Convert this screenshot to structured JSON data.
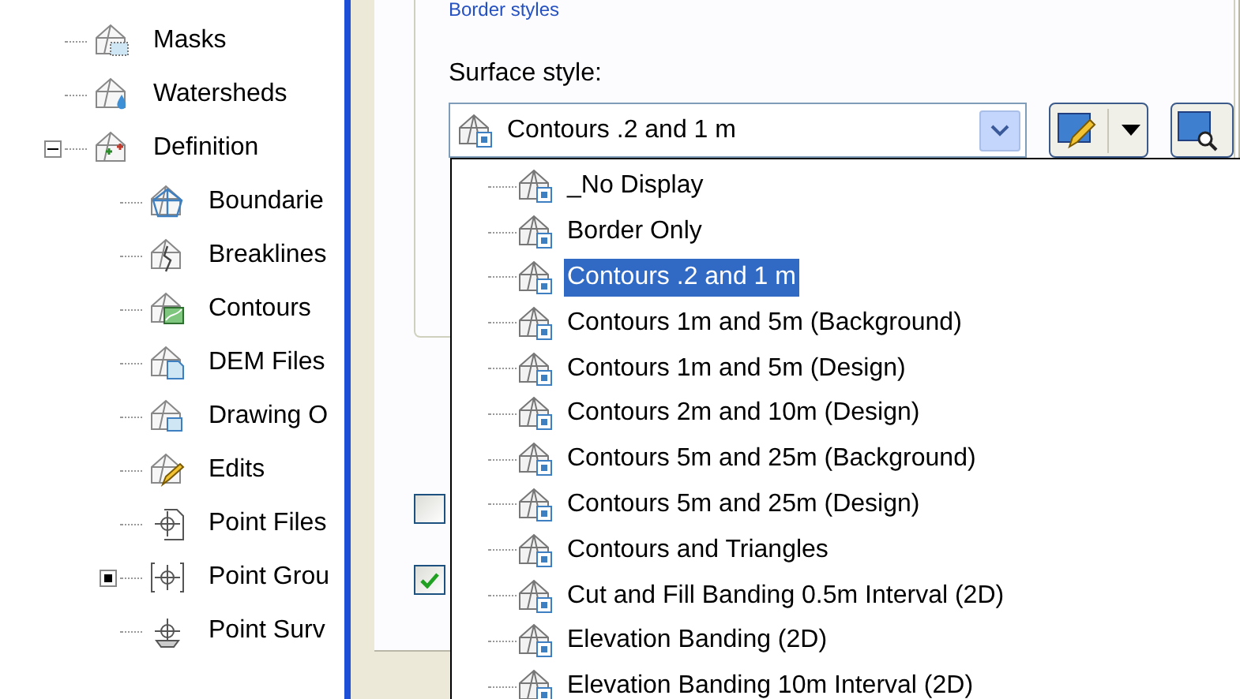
{
  "tree": {
    "items": [
      {
        "label": "Masks",
        "kind": "mask"
      },
      {
        "label": "Watersheds",
        "kind": "watershed"
      },
      {
        "label": "Definition",
        "kind": "definition",
        "expanded": true,
        "children": [
          {
            "label": "Boundarie",
            "kind": "boundary"
          },
          {
            "label": "Breaklines",
            "kind": "breakline"
          },
          {
            "label": "Contours",
            "kind": "contour"
          },
          {
            "label": "DEM Files",
            "kind": "dem"
          },
          {
            "label": "Drawing O",
            "kind": "drawing"
          },
          {
            "label": "Edits",
            "kind": "edit"
          },
          {
            "label": "Point Files",
            "kind": "pointfile"
          },
          {
            "label": "Point Grou",
            "kind": "pointgroup",
            "expanded": false
          },
          {
            "label": "Point Surv",
            "kind": "pointsurvey"
          }
        ]
      }
    ]
  },
  "group": {
    "title": "Border styles",
    "surface_style": {
      "label": "Surface style:",
      "value": "Contours .2 and 1 m"
    }
  },
  "checkboxes": [
    {
      "checked": false
    },
    {
      "checked": true
    }
  ],
  "style_list": [
    {
      "label": "_No Display",
      "selected": false
    },
    {
      "label": "Border Only",
      "selected": false
    },
    {
      "label": "Contours .2 and 1 m",
      "selected": true
    },
    {
      "label": "Contours 1m and 5m (Background)",
      "selected": false
    },
    {
      "label": "Contours 1m and 5m (Design)",
      "selected": false
    },
    {
      "label": "Contours 2m and 10m (Design)",
      "selected": false
    },
    {
      "label": "Contours 5m and 25m (Background)",
      "selected": false
    },
    {
      "label": "Contours 5m and 25m (Design)",
      "selected": false
    },
    {
      "label": "Contours and Triangles",
      "selected": false
    },
    {
      "label": "Cut and Fill Banding 0.5m Interval (2D)",
      "selected": false
    },
    {
      "label": "Elevation Banding (2D)",
      "selected": false
    },
    {
      "label": "Elevation Banding 10m Interval (2D)",
      "selected": false
    }
  ]
}
